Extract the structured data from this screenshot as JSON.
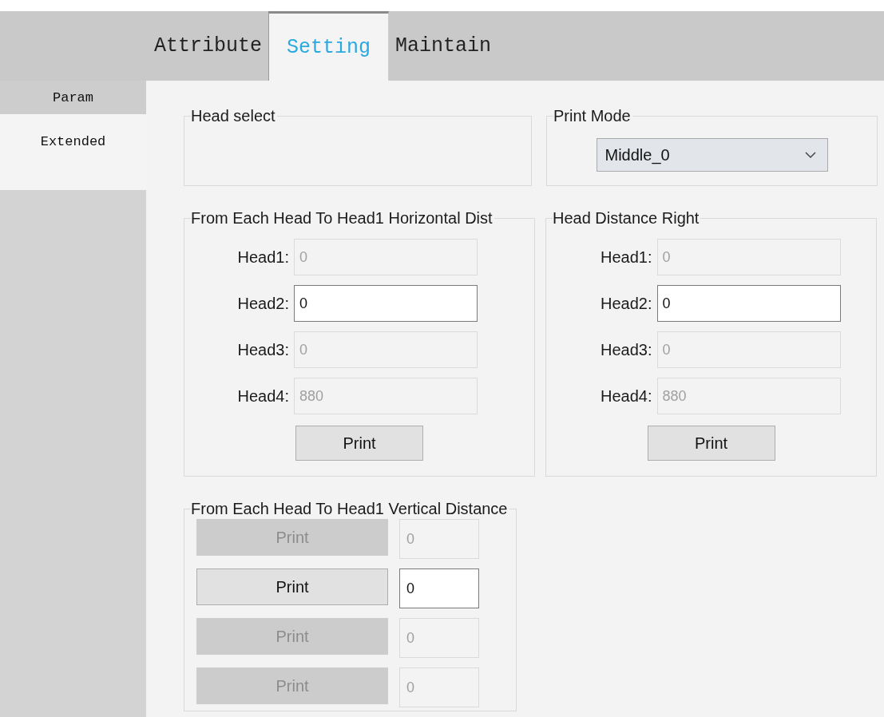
{
  "tabs": [
    {
      "label": "Attribute",
      "selected": false
    },
    {
      "label": "Setting",
      "selected": true
    },
    {
      "label": "Maintain",
      "selected": false
    }
  ],
  "sidebar": {
    "items": [
      {
        "label": "Param",
        "selected": false
      },
      {
        "label": "Extended",
        "selected": true
      }
    ]
  },
  "head_select": {
    "title": "Head select"
  },
  "print_mode": {
    "title": "Print Mode",
    "value": "Middle_0"
  },
  "horizontal_distance": {
    "title": "From Each Head To Head1 Horizontal Dist",
    "fields": [
      {
        "label": "Head1:",
        "value": "0",
        "disabled": true
      },
      {
        "label": "Head2:",
        "value": "0",
        "disabled": false
      },
      {
        "label": "Head3:",
        "value": "0",
        "disabled": true
      },
      {
        "label": "Head4:",
        "value": "880",
        "disabled": true
      }
    ],
    "button": "Print"
  },
  "head_distance_right": {
    "title": "Head Distance Right",
    "fields": [
      {
        "label": "Head1:",
        "value": "0",
        "disabled": true
      },
      {
        "label": "Head2:",
        "value": "0",
        "disabled": false
      },
      {
        "label": "Head3:",
        "value": "0",
        "disabled": true
      },
      {
        "label": "Head4:",
        "value": "880",
        "disabled": true
      }
    ],
    "button": "Print"
  },
  "vertical_distance": {
    "title": "From Each Head To Head1 Vertical Distance",
    "rows": [
      {
        "button": "Print",
        "value": "0",
        "disabled": true
      },
      {
        "button": "Print",
        "value": "0",
        "disabled": false
      },
      {
        "button": "Print",
        "value": "0",
        "disabled": true
      },
      {
        "button": "Print",
        "value": "0",
        "disabled": true
      }
    ]
  }
}
